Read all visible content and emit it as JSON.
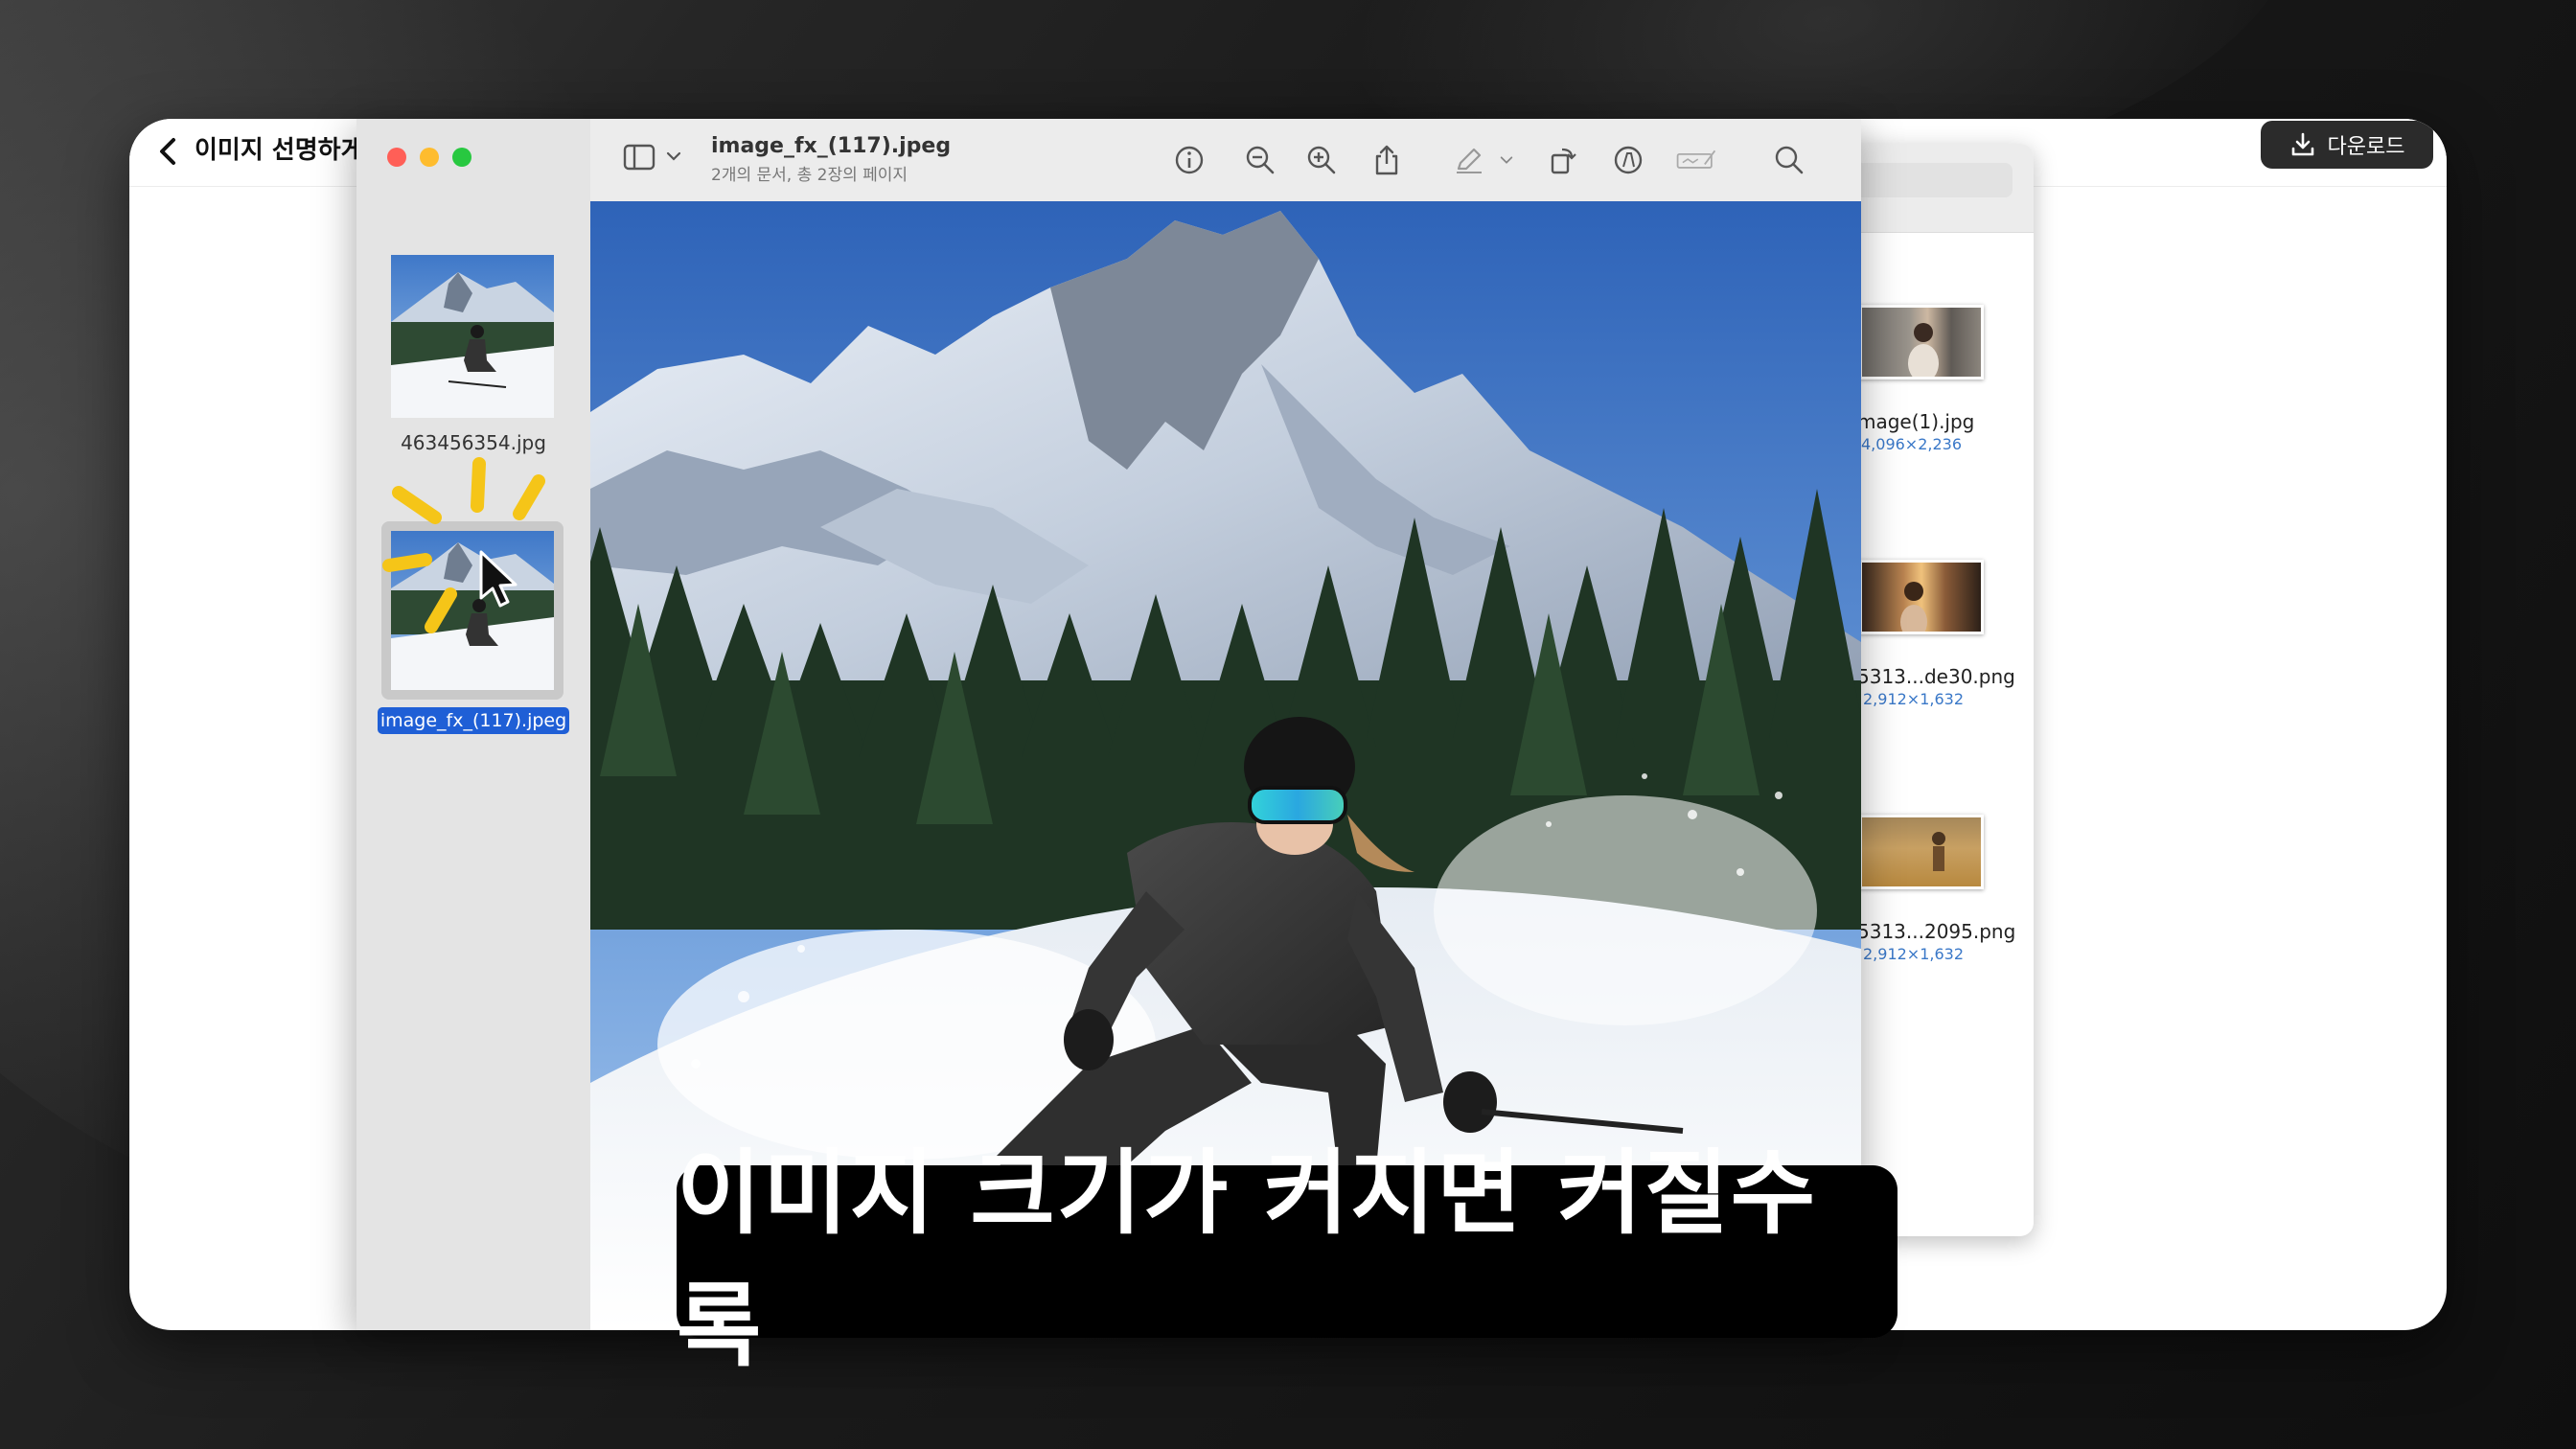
{
  "main_window": {
    "title": "이미지 선명하게",
    "download_label": "다운로드"
  },
  "preview": {
    "document_title": "image_fx_(117).jpeg",
    "document_subtitle": "2개의 문서, 총 2장의 페이지",
    "sidebar": {
      "items": [
        {
          "label": "463456354.jpg",
          "selected": false
        },
        {
          "label": "image_fx_(117).jpeg",
          "selected": true
        }
      ]
    },
    "toolbar_icons": [
      "sidebar-toggle-icon",
      "info-icon",
      "zoom-out-icon",
      "zoom-in-icon",
      "share-icon",
      "markup-pen-icon",
      "rotate-icon",
      "markup-circle-icon",
      "signature-icon",
      "search-icon"
    ]
  },
  "finder": {
    "items": [
      {
        "name": "mage(1).jpg",
        "dims": "4,096×2,236"
      },
      {
        "name": "5313...de30.png",
        "dims": "2,912×1,632"
      },
      {
        "name": "5313...2095.png",
        "dims": "2,912×1,632"
      }
    ]
  },
  "caption": {
    "text": "이미지 크기가 커지면 커질수록"
  },
  "colors": {
    "selection_blue": "#1f5fd6",
    "traffic_red": "#ff5f57",
    "traffic_yellow": "#febc2e",
    "traffic_green": "#28c840",
    "download_button_bg": "#2b2b2b",
    "sparkle_yellow": "#f5c518"
  }
}
